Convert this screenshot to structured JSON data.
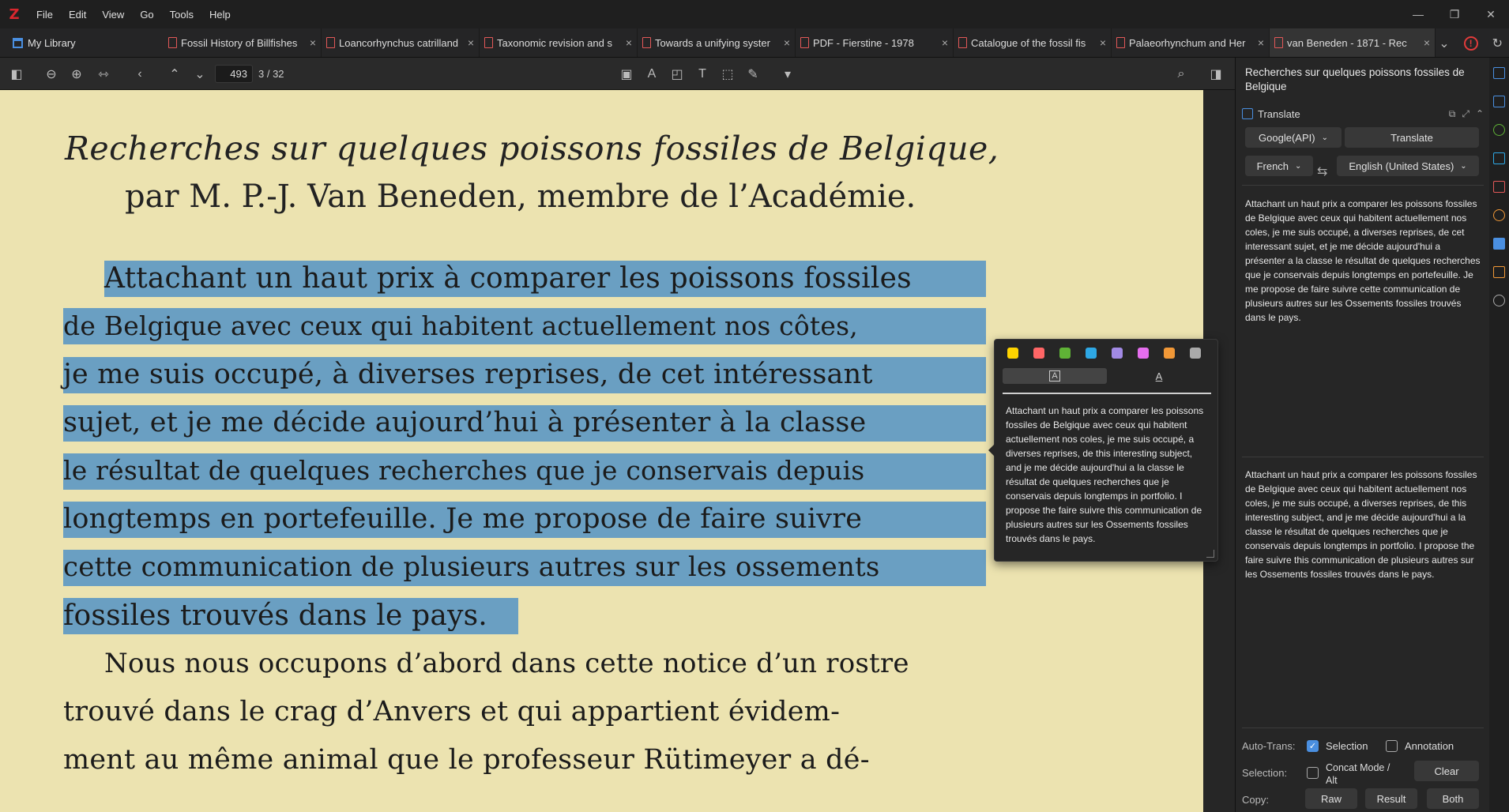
{
  "app": {
    "logo": "Z"
  },
  "menu": [
    "File",
    "Edit",
    "View",
    "Go",
    "Tools",
    "Help"
  ],
  "window_controls": {
    "minimize": "—",
    "restore": "❐",
    "close": "✕"
  },
  "library_tab": "My Library",
  "tabs": [
    "Fossil History of Billfishes",
    "Loancorhynchus catrilland",
    "Taxonomic revision and s",
    "Towards a unifying syster",
    "PDF - Fierstine - 1978",
    "Catalogue of the fossil fis",
    "Palaeorhynchum and Her",
    "van Beneden - 1871 - Rec"
  ],
  "toolbar": {
    "page_value": "493",
    "page_count": "3 / 32"
  },
  "pdf": {
    "title": "Recherches sur quelques poissons fossiles de Belgique,",
    "author": "par M. P.-J. Van Beneden, membre de l’Académie.",
    "highlighted_lines": [
      "Attachant un haut prix à comparer les poissons fossiles",
      "de Belgique avec ceux qui habitent actuellement nos côtes,",
      "je me suis occupé, à diverses reprises, de cet intéressant",
      "sujet, et je me décide aujourd’hui à présenter à la classe",
      "le résultat de quelques recherches que je conservais depuis",
      "longtemps en portefeuille. Je me propose de faire suivre",
      "cette communication de plusieurs autres sur les ossements",
      "fossiles trouvés dans le pays."
    ],
    "body_lines": [
      "Nous nous occupons d’abord dans cette notice d’un rostre",
      "trouvé dans le crag d’Anvers et qui appartient évidem-",
      "ment au même animal que le professeur Rütimeyer a dé-"
    ]
  },
  "popup": {
    "colors": [
      "#ffd400",
      "#ff6666",
      "#5fb236",
      "#2ea8e5",
      "#a28ae5",
      "#e56eee",
      "#f19837",
      "#aaaaaa"
    ],
    "highlight_glyph": "A",
    "underline_glyph": "A",
    "translation": "Attachant un haut prix a comparer les poissons fossiles de Belgique avec ceux qui habitent actuellement nos coles, je me suis occupé, a diverses reprises, de this interesting subject, and je me décide aujourd'hui a la classe le résultat de quelques recherches que je conservais depuis longtemps in portfolio. I propose the faire suivre this communication de plusieurs autres sur les Ossements fossiles trouvés dans le pays."
  },
  "panel": {
    "title": "Recherches sur quelques poissons fossiles de Belgique",
    "section": "Translate",
    "engine": "Google(API)",
    "translate_button": "Translate",
    "source_lang": "French",
    "target_lang": "English (United States)",
    "source_text": "Attachant un haut prix a comparer les poissons fossiles de Belgique avec ceux qui habitent actuellement nos coles,  je me suis occupé, a diverses reprises, de cet interessant  sujet, et je me décide aujourd'hui a présenter a la classe  le résultat de quelques recherches que je conservais depuis  longtemps en portefeuille. Je me propose de faire suivre  cette communication de plusieurs autres sur les Ossements  fossiles trouvés dans le pays.",
    "result_text": "Attachant un haut prix a comparer les poissons fossiles de Belgique avec ceux qui habitent actuellement nos coles, je me suis occupé, a diverses reprises, de this interesting subject, and je me décide aujourd'hui a la classe le résultat de quelques recherches que je conservais depuis longtemps in portfolio. I propose the faire suivre this communication de plusieurs autres sur les Ossements fossiles trouvés dans le pays.",
    "auto_trans_label": "Auto-Trans:",
    "selection_option": "Selection",
    "annotation_option": "Annotation",
    "selection_label": "Selection:",
    "concat_option": "Concat Mode / Alt",
    "clear_button": "Clear",
    "copy_label": "Copy:",
    "raw_button": "Raw",
    "result_button": "Result",
    "both_button": "Both"
  }
}
